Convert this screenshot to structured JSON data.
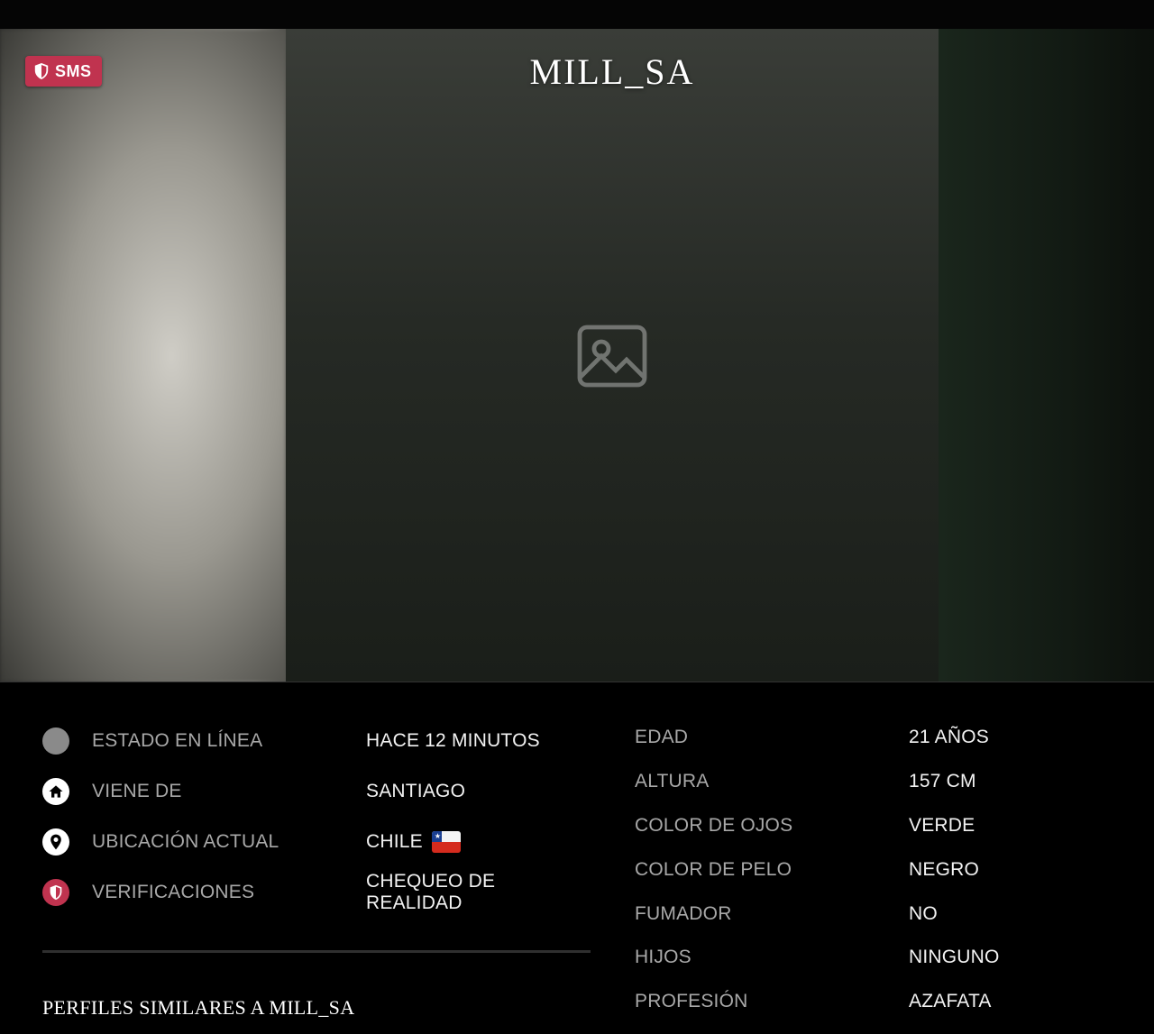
{
  "profile": {
    "name": "MILL_SA",
    "badge_label": "SMS",
    "photo_alt": "Foto de perfil"
  },
  "status": [
    {
      "icon": "online-status-dot-icon",
      "label": "ESTADO EN LÍNEA",
      "value": "HACE 12 MINUTOS"
    },
    {
      "icon": "home-icon",
      "label": "VIENE DE",
      "value": "SANTIAGO"
    },
    {
      "icon": "location-pin-icon",
      "label": "UBICACIÓN ACTUAL",
      "value": "CHILE",
      "flag": "chile-flag-icon"
    },
    {
      "icon": "shield-icon",
      "label": "VERIFICACIONES",
      "value": "CHEQUEO DE REALIDAD"
    }
  ],
  "attributes": [
    {
      "label": "EDAD",
      "value": "21 AÑOS"
    },
    {
      "label": "ALTURA",
      "value": "157 CM"
    },
    {
      "label": "COLOR DE OJOS",
      "value": "VERDE"
    },
    {
      "label": "COLOR DE PELO",
      "value": "NEGRO"
    },
    {
      "label": "FUMADOR",
      "value": "NO"
    },
    {
      "label": "HIJOS",
      "value": "NINGUNO"
    },
    {
      "label": "PROFESIÓN",
      "value": "AZAFATA"
    }
  ],
  "similar_heading": "PERFILES SIMILARES A MILL_SA",
  "colors": {
    "badge": "#c0334f",
    "verification_icon": "#c0334f",
    "label_gray": "#a8a8a8",
    "online_dot": "#8a8a8a"
  }
}
